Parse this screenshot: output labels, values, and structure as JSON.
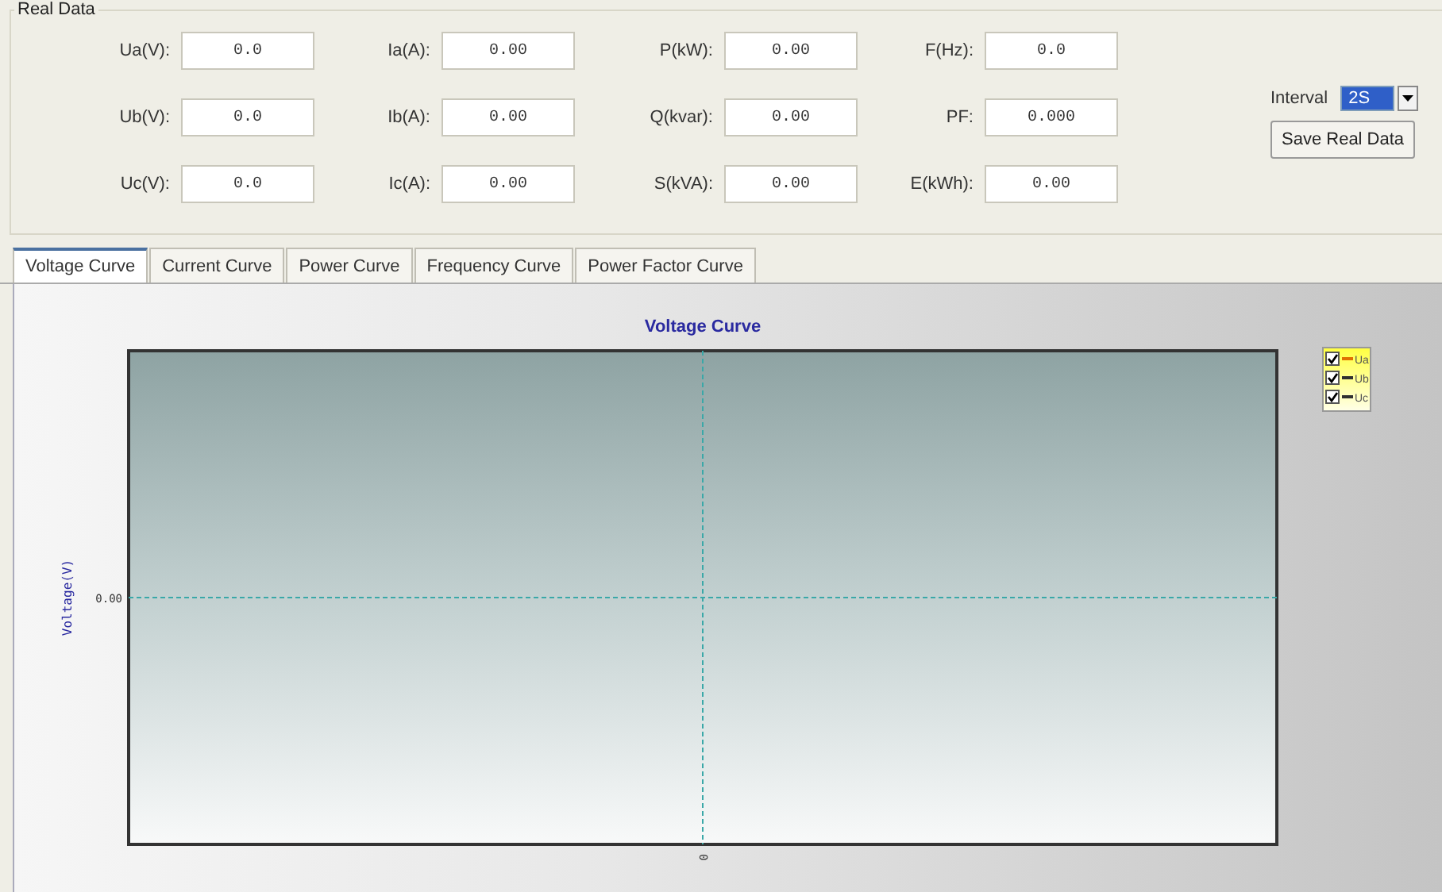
{
  "group": {
    "title": "Real Data"
  },
  "fields": [
    {
      "label": "Ua(V):",
      "value": "0.0"
    },
    {
      "label": "Ia(A):",
      "value": "0.00"
    },
    {
      "label": "P(kW):",
      "value": "0.00"
    },
    {
      "label": "F(Hz):",
      "value": "0.0"
    },
    {
      "label": "Ub(V):",
      "value": "0.0"
    },
    {
      "label": "Ib(A):",
      "value": "0.00"
    },
    {
      "label": "Q(kvar):",
      "value": "0.00"
    },
    {
      "label": "PF:",
      "value": "0.000"
    },
    {
      "label": "Uc(V):",
      "value": "0.0"
    },
    {
      "label": "Ic(A):",
      "value": "0.00"
    },
    {
      "label": "S(kVA):",
      "value": "0.00"
    },
    {
      "label": "E(kWh):",
      "value": "0.00"
    }
  ],
  "interval": {
    "label": "Interval",
    "value": "2S"
  },
  "save_button": "Save Real Data",
  "tabs": [
    {
      "label": "Voltage Curve",
      "selected": true
    },
    {
      "label": "Current Curve",
      "selected": false
    },
    {
      "label": "Power Curve",
      "selected": false
    },
    {
      "label": "Frequency Curve",
      "selected": false
    },
    {
      "label": "Power Factor Curve",
      "selected": false
    }
  ],
  "chart": {
    "title": "Voltage Curve",
    "y_axis_title": "Voltage(V)",
    "y_tick_label": "0.00",
    "x_tick_label": "0",
    "legend": [
      {
        "label": "Ua",
        "color": "#e07000",
        "checked": true
      },
      {
        "label": "Ub",
        "color": "#303030",
        "checked": true
      },
      {
        "label": "Uc",
        "color": "#303030",
        "checked": true
      }
    ]
  }
}
